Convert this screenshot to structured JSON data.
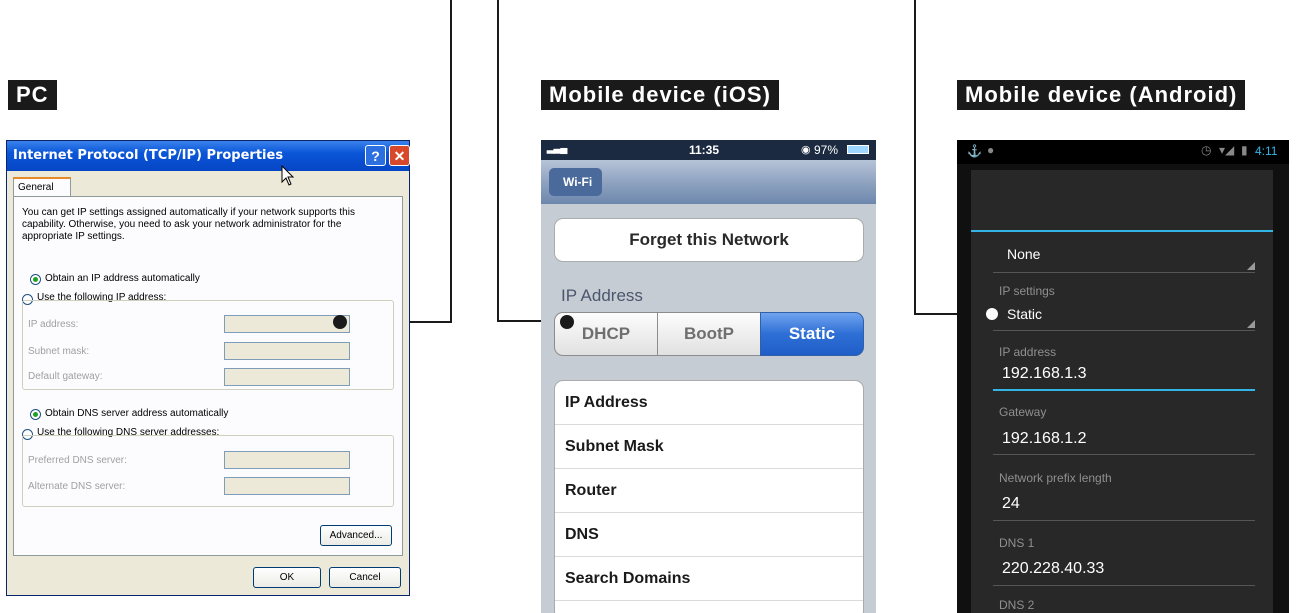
{
  "sections": {
    "pc": "PC",
    "ios": "Mobile device (iOS)",
    "android": "Mobile device (Android)"
  },
  "xp_dialog": {
    "title": "Internet Protocol (TCP/IP) Properties",
    "help_glyph": "?",
    "close_glyph": "✕",
    "tab_general": "General",
    "description": "You can get IP settings assigned automatically if your network supports this capability. Otherwise, you need to ask your network administrator for the appropriate IP settings.",
    "radio_obtain_ip": "Obtain an IP address automatically",
    "radio_use_ip": "Use the following IP address:",
    "ip_address_label": "IP address:",
    "subnet_mask_label": "Subnet mask:",
    "default_gateway_label": "Default gateway:",
    "radio_obtain_dns": "Obtain DNS server address automatically",
    "radio_use_dns": "Use the following DNS server addresses:",
    "preferred_dns_label": "Preferred DNS server:",
    "alternate_dns_label": "Alternate DNS server:",
    "advanced_button": "Advanced...",
    "ok_button": "OK",
    "cancel_button": "Cancel"
  },
  "ios": {
    "status_time": "11:35",
    "status_battery": "97%",
    "back_button": "Wi-Fi",
    "forget_button": "Forget this Network",
    "ip_section_label": "IP Address",
    "segments": [
      "DHCP",
      "BootP",
      "Static"
    ],
    "selected_segment": "Static",
    "rows": [
      "IP Address",
      "Subnet Mask",
      "Router",
      "DNS",
      "Search Domains"
    ]
  },
  "android": {
    "status_time": "4:11",
    "proxy_value": "None",
    "ip_settings_label": "IP settings",
    "ip_settings_value": "Static",
    "ip_address_label": "IP address",
    "ip_address_value": "192.168.1.3",
    "gateway_label": "Gateway",
    "gateway_value": "192.168.1.2",
    "prefix_label": "Network prefix length",
    "prefix_value": "24",
    "dns1_label": "DNS 1",
    "dns1_value": "220.228.40.33",
    "dns2_label": "DNS 2"
  },
  "colors": {
    "xp_titlebar": "#0a56d8",
    "ios_static_selected": "#3a7ad8",
    "android_accent": "#33b5e5"
  }
}
